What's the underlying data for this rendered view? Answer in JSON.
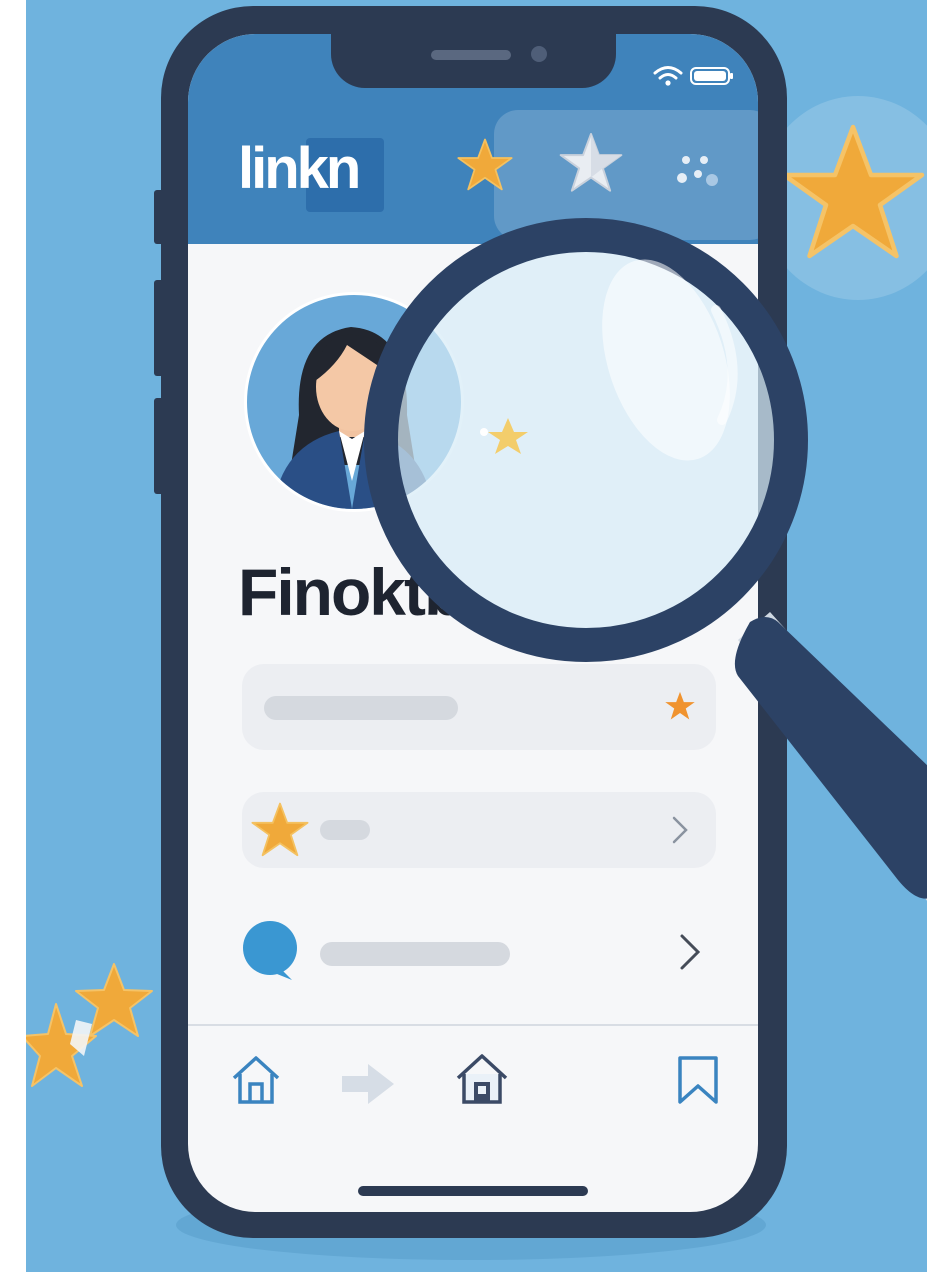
{
  "app": {
    "logo_text": "linkn",
    "profile_name": "Finoktb"
  },
  "colors": {
    "background": "#6fb3de",
    "phone_frame": "#2c3a52",
    "header": "#3f83bb",
    "star": "#f0a93a",
    "magnifier_handle": "#2c4265"
  },
  "icons": {
    "header": [
      "star-icon",
      "star-icon",
      "dots-icon"
    ],
    "status": [
      "wifi-icon",
      "battery-icon"
    ],
    "list": [
      "star-icon",
      "chat-bubble-icon"
    ],
    "tabbar": [
      "home-icon",
      "share-arrow-icon",
      "house-icon",
      "bookmark-icon"
    ]
  }
}
